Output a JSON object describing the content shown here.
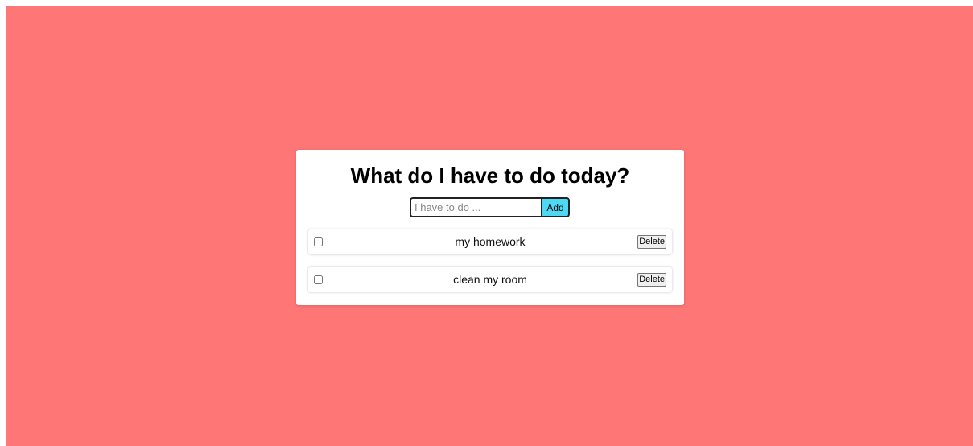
{
  "colors": {
    "background": "#ff7676",
    "card": "#ffffff",
    "add_button": "#4dd8f5"
  },
  "title": "What do I have to do today?",
  "form": {
    "input_placeholder": "I have to do ...",
    "input_value": "",
    "add_label": "Add"
  },
  "todos": [
    {
      "text": "my homework",
      "checked": false,
      "delete_label": "Delete"
    },
    {
      "text": "clean my room",
      "checked": false,
      "delete_label": "Delete"
    }
  ]
}
